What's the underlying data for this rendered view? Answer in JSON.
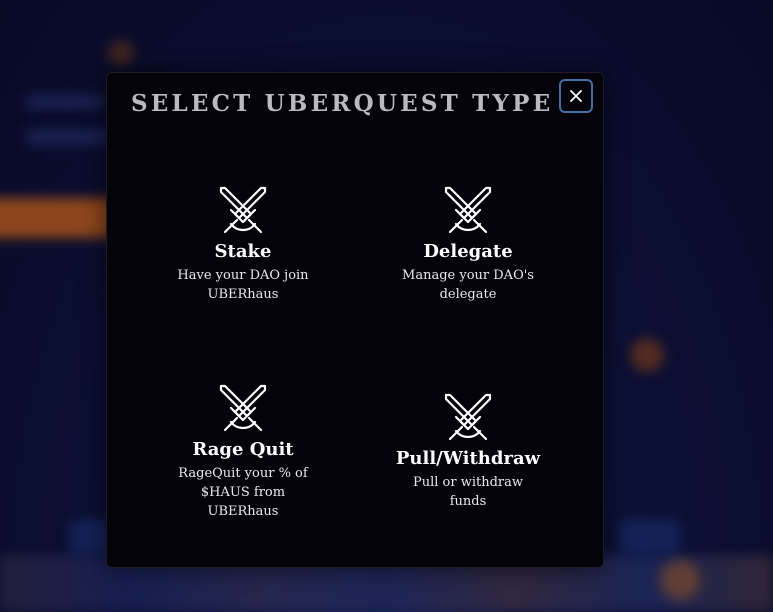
{
  "modal": {
    "title": "SELECT UBERQUEST TYPE",
    "close_icon": "close-icon"
  },
  "options": [
    {
      "title": "Stake",
      "description": "Have your DAO join UBERhaus",
      "icon": "crossed-swords-icon"
    },
    {
      "title": "Delegate",
      "description": "Manage your DAO's delegate",
      "icon": "crossed-swords-icon"
    },
    {
      "title": "Rage Quit",
      "description": "RageQuit your % of $HAUS from UBERhaus",
      "icon": "crossed-swords-icon"
    },
    {
      "title": "Pull/Withdraw",
      "description": "Pull or withdraw funds",
      "icon": "crossed-swords-icon"
    }
  ],
  "colors": {
    "modal_background": "#030309",
    "title_text": "#b9b9c0",
    "close_border": "#3f6fa8",
    "page_background": "#0a0c2a"
  }
}
